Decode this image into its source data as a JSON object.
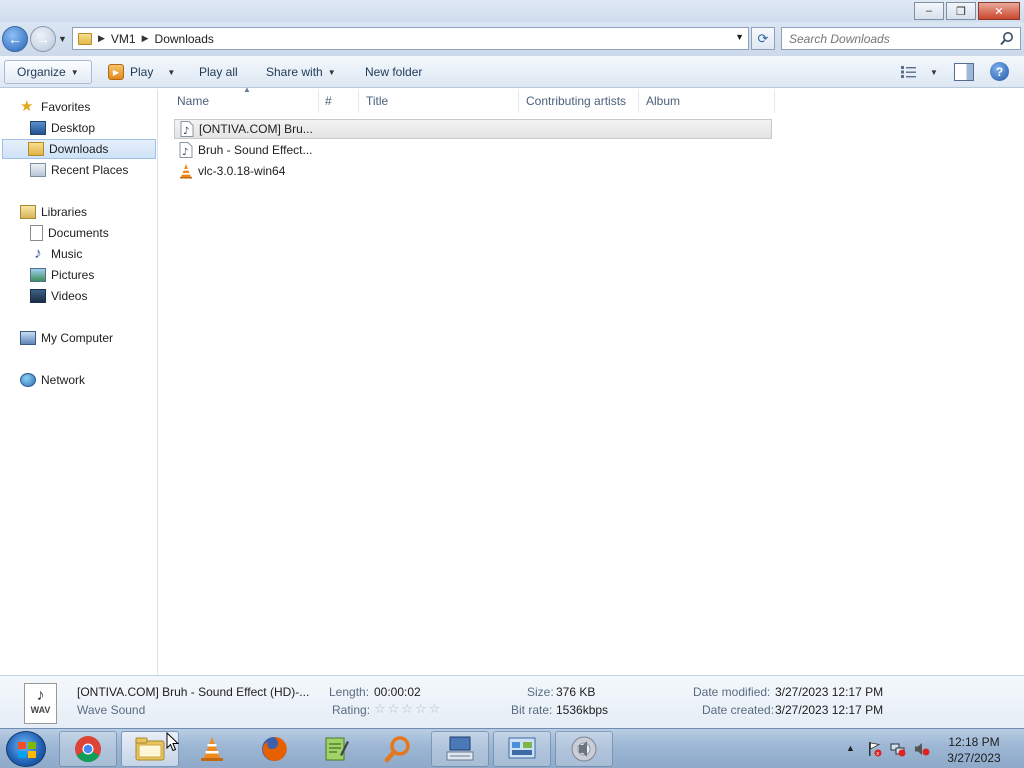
{
  "window": {
    "minimize_glyph": "–",
    "restore_glyph": "❐",
    "close_glyph": "✕"
  },
  "address": {
    "crumbs": [
      "VM1",
      "Downloads"
    ],
    "search_placeholder": "Search Downloads"
  },
  "toolbar": {
    "organize": "Organize",
    "play": "Play",
    "play_all": "Play all",
    "share_with": "Share with",
    "new_folder": "New folder"
  },
  "nav": {
    "favorites": "Favorites",
    "desktop": "Desktop",
    "downloads": "Downloads",
    "recent_places": "Recent Places",
    "libraries": "Libraries",
    "documents": "Documents",
    "music": "Music",
    "pictures": "Pictures",
    "videos": "Videos",
    "my_computer": "My Computer",
    "network": "Network"
  },
  "columns": {
    "name": "Name",
    "number": "#",
    "title": "Title",
    "artists": "Contributing artists",
    "album": "Album"
  },
  "files": [
    {
      "name": "[ONTIVA.COM] Bru...",
      "icon": "audio-file-icon"
    },
    {
      "name": "Bruh - Sound Effect...",
      "icon": "audio-file-icon"
    },
    {
      "name": "vlc-3.0.18-win64",
      "icon": "vlc-cone-icon"
    }
  ],
  "details": {
    "icon_label": "WAV",
    "filename": "[ONTIVA.COM] Bruh - Sound Effect (HD)-...",
    "type": "Wave Sound",
    "length_label": "Length:",
    "length": "00:00:02",
    "rating_label": "Rating:",
    "rating_stars": "☆☆☆☆☆",
    "size_label": "Size:",
    "size": "376 KB",
    "bitrate_label": "Bit rate:",
    "bitrate": "1536kbps",
    "modified_label": "Date modified:",
    "modified": "3/27/2023 12:17 PM",
    "created_label": "Date created:",
    "created": "3/27/2023 12:17 PM"
  },
  "taskbar": {
    "time": "12:18 PM",
    "date": "3/27/2023"
  },
  "colors": {
    "accent": "#2564b8",
    "selection": "#cfe2f7"
  }
}
